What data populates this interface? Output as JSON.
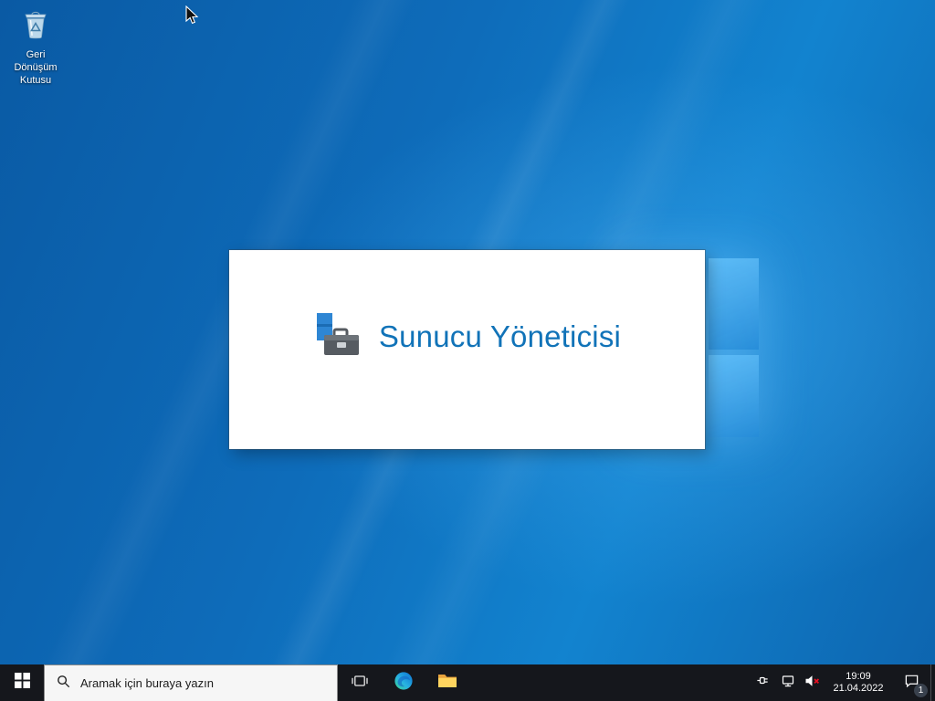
{
  "desktop": {
    "recycle_bin": {
      "label": "Geri Dönüşüm Kutusu"
    }
  },
  "splash": {
    "title": "Sunucu Yöneticisi"
  },
  "taskbar": {
    "search": {
      "placeholder": "Aramak için buraya yazın"
    },
    "tray": {
      "time": "19:09",
      "date": "21.04.2022",
      "badge": "1"
    }
  },
  "icons": {
    "recycle_bin": "recycle-bin",
    "cursor": "arrow-pointer",
    "server_manager": "toolbox-with-server-flag",
    "start": "windows-logo",
    "search": "magnifier",
    "task_view": "task-view-frames",
    "edge": "edge-browser-swirl",
    "file_explorer": "yellow-folder",
    "power": "power-plug",
    "network": "ethernet-monitor",
    "volume": "speaker-muted-red-x",
    "action_center": "notification-bubble"
  },
  "colors": {
    "wallpaper_base": "#0d64ae",
    "logo_pane": "#3aa4ea",
    "taskbar_bg": "#15171c",
    "splash_title": "#1173b8",
    "search_bg": "#f6f6f6",
    "mute_x": "#e81123",
    "folder_yellow": "#ffd55f"
  }
}
